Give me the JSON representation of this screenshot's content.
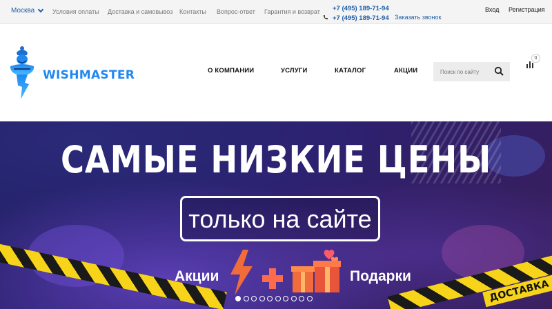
{
  "topbar": {
    "city": "Москва",
    "links": [
      "Условия оплаты",
      "Доставка и самовывоз",
      "Контакты",
      "Вопрос-ответ",
      "Гарантия и возврат"
    ],
    "phones": [
      "+7 (495) 189-71-94",
      "+7 (495) 189-71-94"
    ],
    "callback": "Заказать звонок",
    "login": "Вход",
    "register": "Регистрация"
  },
  "header": {
    "logo_text": "WISHMASTER",
    "nav": [
      "О КОМПАНИИ",
      "УСЛУГИ",
      "КАТАЛОГ",
      "АКЦИИ"
    ],
    "search_placeholder": "Поиск по сайту",
    "compare_count": "0"
  },
  "banner": {
    "headline": "САМЫЕ НИЗКИЕ ЦЕНЫ",
    "subtitle": "только на сайте",
    "promo_left": "Акции",
    "promo_right": "Подарки",
    "tape_text": "ДОСТАВКА СЕ",
    "slides_total": 10,
    "active_slide": 1
  },
  "colors": {
    "accent": "#1f5fa8",
    "brand": "#1e88f0",
    "tape": "#f7d31a",
    "promo": "#f26b3a"
  },
  "icons": {
    "city_dropdown": "chevron-down-icon",
    "phone": "phone-icon",
    "search": "search-icon",
    "compare": "bar-chart-icon"
  }
}
